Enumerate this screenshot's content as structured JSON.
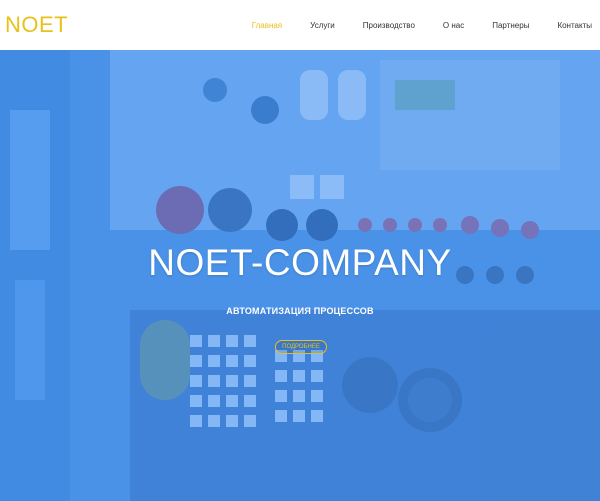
{
  "brand": {
    "logo_text": "NOET",
    "accent_color": "#e8c21b"
  },
  "nav": {
    "items": [
      {
        "label": "Главная",
        "active": true
      },
      {
        "label": "Услуги",
        "active": false
      },
      {
        "label": "Производство",
        "active": false
      },
      {
        "label": "О нас",
        "active": false
      },
      {
        "label": "Партнеры",
        "active": false
      },
      {
        "label": "Контакты",
        "active": false
      }
    ]
  },
  "hero": {
    "title": "NOET-COMPANY",
    "subtitle": "АВТОМАТИЗАЦИЯ ПРОЦЕССОВ",
    "button_label": "ПОДРОБНЕЕ",
    "overlay_color": "#58a3ee"
  }
}
